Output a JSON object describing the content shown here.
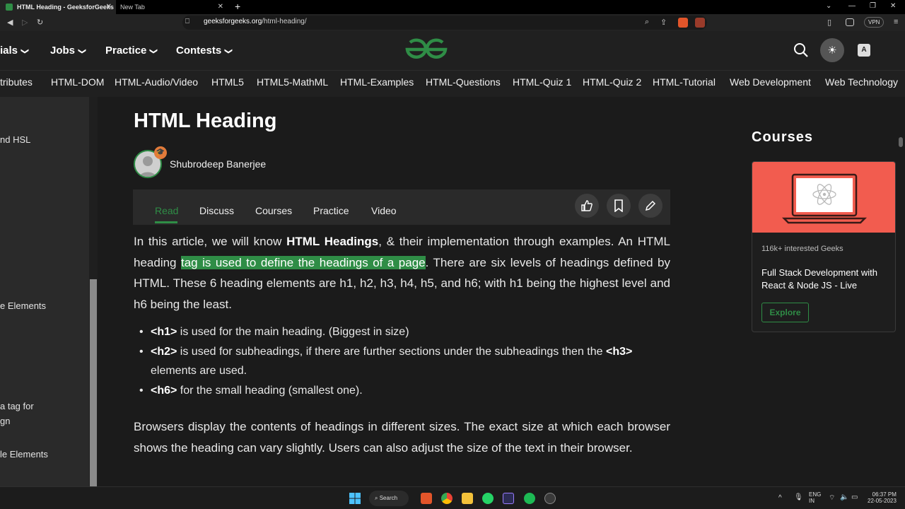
{
  "browser": {
    "tabs": [
      {
        "label": "HTML Heading - GeeksforGeeks",
        "active": true
      },
      {
        "label": "New Tab",
        "active": false
      }
    ],
    "new_tab": "+",
    "url_host": "geeksforgeeks.org",
    "url_path": "/html-heading/",
    "vpn_label": "VPN"
  },
  "header": {
    "nav": [
      {
        "label": "ials"
      },
      {
        "label": "Jobs"
      },
      {
        "label": "Practice"
      },
      {
        "label": "Contests"
      }
    ],
    "chevron": "❯",
    "lang_label": "A"
  },
  "categories": [
    "tributes",
    "HTML-DOM",
    "HTML-Audio/Video",
    "HTML5",
    "HTML5-MathML",
    "HTML-Examples",
    "HTML-Questions",
    "HTML-Quiz 1",
    "HTML-Quiz 2",
    "HTML-Tutorial",
    "Web Development",
    "Web Technology"
  ],
  "sidebar": {
    "items": [
      "nd HSL",
      "e Elements",
      "a tag for",
      "gn",
      "le Elements"
    ]
  },
  "article": {
    "title": "HTML Heading",
    "author": "Shubrodeep Banerjee",
    "tabs": [
      "Read",
      "Discuss",
      "Courses",
      "Practice",
      "Video"
    ],
    "p1_a": "In this article, we will know ",
    "p1_bold": "HTML Headings",
    "p1_b": ", & their implementation through examples. An HTML heading ",
    "p1_highlight": "tag is used to define the headings of a page",
    "p1_c": ". There are six levels of headings defined by HTML. These 6 heading elements are h1, h2, h3, h4, h5, and h6; with h1 being the highest level and h6 being the least.",
    "list": [
      {
        "tag": "<h1>",
        "text": " is used for the main heading. (Biggest in size)"
      },
      {
        "tag": "<h2>",
        "text": " is used for subheadings, if there are further sections under the subheadings then the ",
        "tag2": "<h3>",
        "text2": " elements are used."
      },
      {
        "tag": "<h6>",
        "text": " for the small heading (smallest one)."
      }
    ],
    "p2": "Browsers display the contents of headings in different sizes. The exact size at which each browser shows the heading can vary slightly. Users can also adjust the size of the text in their browser."
  },
  "courses": {
    "title": "Courses",
    "interest": "116k+ interested Geeks",
    "name": "Full Stack Development with React & Node JS - Live",
    "button": "Explore"
  },
  "taskbar": {
    "search": "Search",
    "lang1": "ENG",
    "lang2": "IN",
    "time": "06:37 PM",
    "date": "22-05-2023"
  },
  "colors": {
    "accent": "#2f8d46",
    "background": "#1b1b1b",
    "course_banner": "#f25c4f"
  }
}
